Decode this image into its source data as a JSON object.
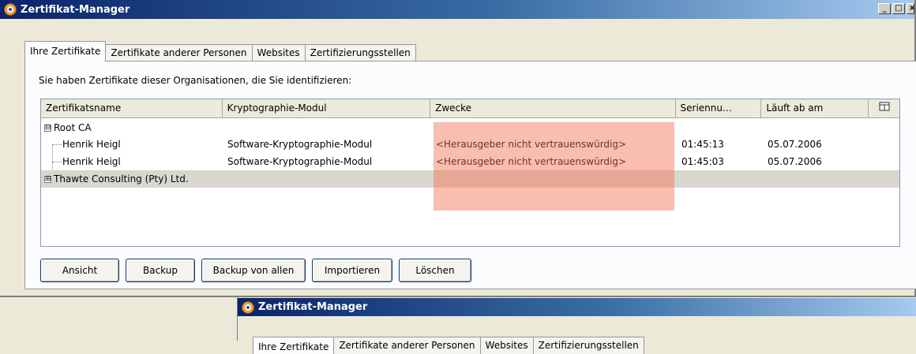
{
  "window": {
    "title": "Zertifikat-Manager"
  },
  "tabs": [
    {
      "label": "Ihre Zertifikate",
      "active": true
    },
    {
      "label": "Zertifikate anderer Personen",
      "active": false
    },
    {
      "label": "Websites",
      "active": false
    },
    {
      "label": "Zertifizierungsstellen",
      "active": false
    }
  ],
  "description": "Sie haben Zertifikate dieser Organisationen, die Sie identifizieren:",
  "table": {
    "columns": [
      "Zertifikatsname",
      "Kryptographie-Modul",
      "Zwecke",
      "Seriennu…",
      "Läuft ab am"
    ],
    "column_picker_icon": "column-picker-icon",
    "groups": [
      {
        "name": "Root CA",
        "expanded": true,
        "expander_glyph": "⊟",
        "rows": [
          {
            "name": "Henrik Heigl",
            "module": "Software-Kryptographie-Modul",
            "purpose": "<Herausgeber nicht vertrauenswürdig>",
            "serial": "01:45:13",
            "expires": "05.07.2006"
          },
          {
            "name": "Henrik Heigl",
            "module": "Software-Kryptographie-Modul",
            "purpose": "<Herausgeber nicht vertrauenswürdig>",
            "serial": "01:45:03",
            "expires": "05.07.2006"
          }
        ]
      },
      {
        "name": "Thawte Consulting (Pty) Ltd.",
        "expanded": false,
        "expander_glyph": "⊞",
        "rows": []
      }
    ]
  },
  "buttons": {
    "view": "Ansicht",
    "backup": "Backup",
    "backup_all": "Backup von allen",
    "import": "Importieren",
    "delete": "Löschen"
  },
  "second_window": {
    "title": "Zertifikat-Manager"
  },
  "colors": {
    "highlight": "#f36e50",
    "selected_row": "#d9d7cd",
    "title_start": "#0a246a"
  }
}
